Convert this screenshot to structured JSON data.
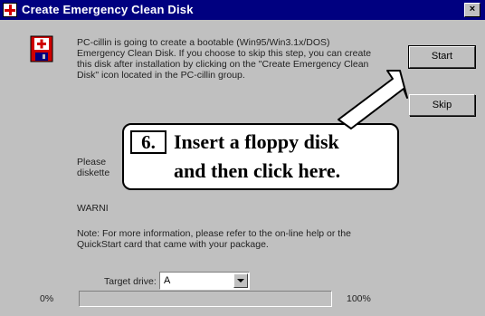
{
  "window": {
    "title": "Create Emergency Clean Disk",
    "close_label": "×"
  },
  "body": {
    "intro": "PC-cillin is going to create a bootable (Win95/Win3.1x/DOS) Emergency Clean Disk. If you choose to skip this step, you can create this disk after installation by clicking on the \"Create Emergency Clean Disk\" icon located in the PC-cillin group.",
    "please": "Please diskette",
    "warning": "WARNI",
    "note": "Note: For more information, please refer to the on-line help or the QuickStart card that came with your package."
  },
  "buttons": {
    "start_label": "Start",
    "skip_label": "Skip"
  },
  "target_drive": {
    "label": "Target drive:",
    "value": "A"
  },
  "progress": {
    "start_label": "0%",
    "end_label": "100%",
    "value": 0
  },
  "callout": {
    "number": "6.",
    "line1": "Insert a floppy disk",
    "line2": "and then click here."
  },
  "colors": {
    "titlebar": "#000080",
    "dialog": "#c0c0c0",
    "icon_cross": "#d00000"
  }
}
